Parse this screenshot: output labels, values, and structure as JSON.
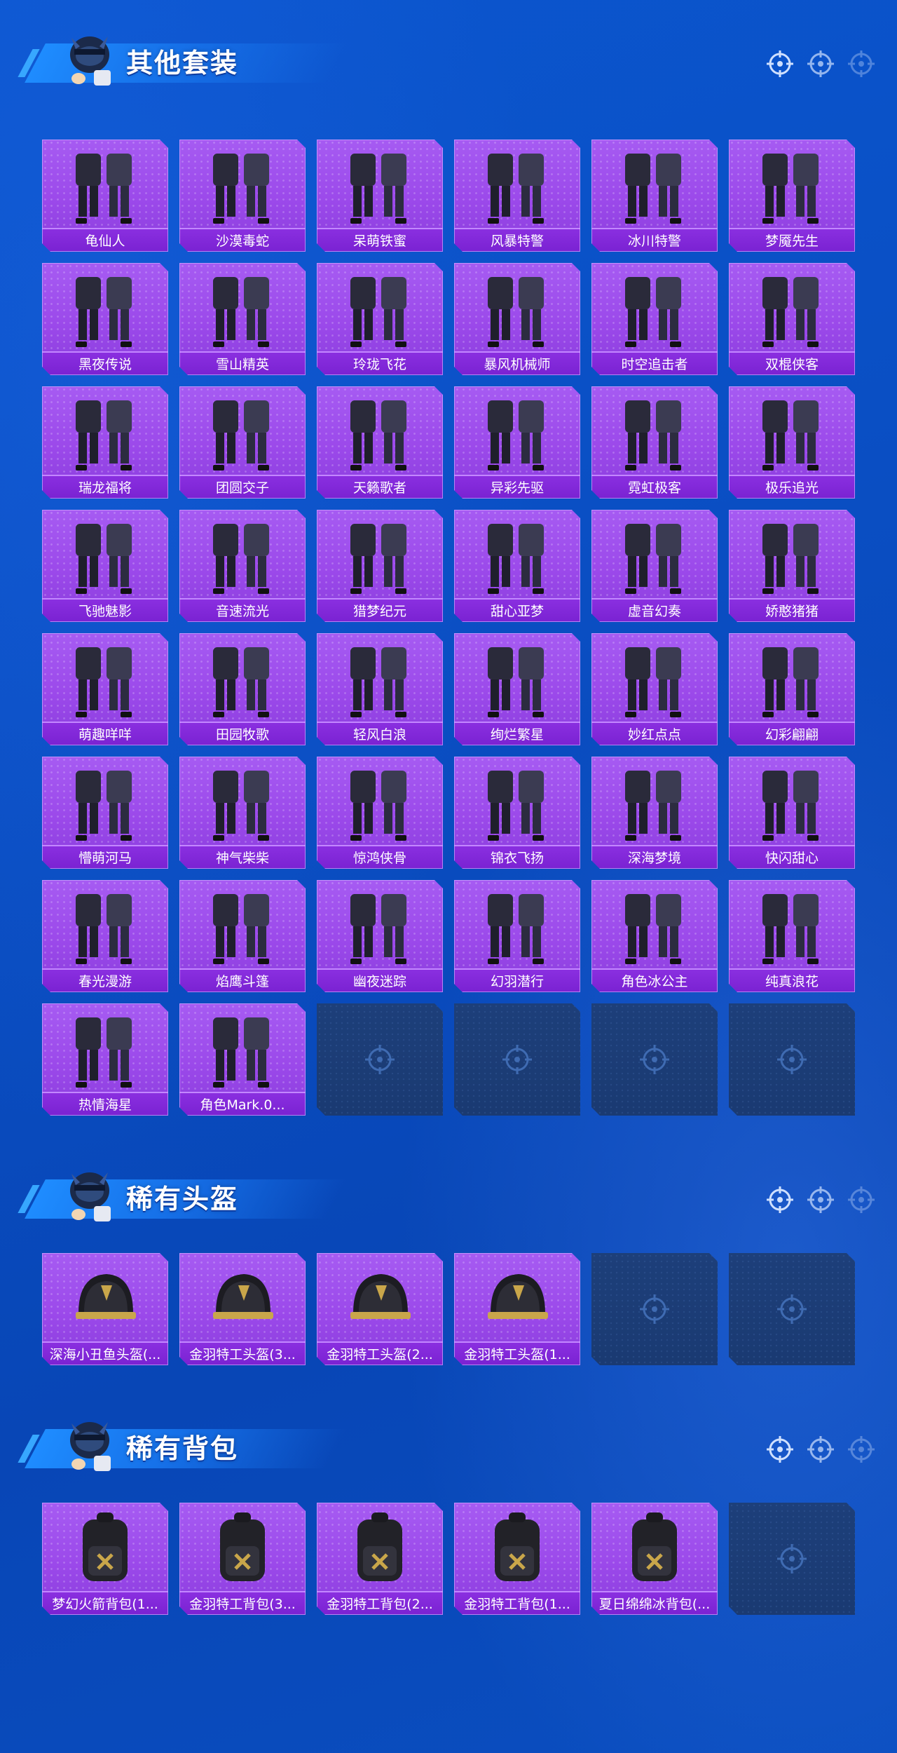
{
  "colors": {
    "background": "#0a4fc4",
    "card_purple": "#9b49ea",
    "label_bar": "#7a22d2",
    "empty_slot": "#1a3a72"
  },
  "sections": {
    "outfits": {
      "title": "其他套装",
      "items": [
        {
          "name": "龟仙人",
          "icon": "outfit-icon"
        },
        {
          "name": "沙漠毒蛇",
          "icon": "outfit-icon"
        },
        {
          "name": "呆萌铁蜜",
          "icon": "outfit-icon"
        },
        {
          "name": "风暴特警",
          "icon": "outfit-icon"
        },
        {
          "name": "冰川特警",
          "icon": "outfit-icon"
        },
        {
          "name": "梦魇先生",
          "icon": "outfit-icon"
        },
        {
          "name": "黑夜传说",
          "icon": "outfit-icon"
        },
        {
          "name": "雪山精英",
          "icon": "outfit-icon"
        },
        {
          "name": "玲珑飞花",
          "icon": "outfit-icon"
        },
        {
          "name": "暴风机械师",
          "icon": "outfit-icon"
        },
        {
          "name": "时空追击者",
          "icon": "outfit-icon"
        },
        {
          "name": "双棍侠客",
          "icon": "outfit-icon"
        },
        {
          "name": "瑞龙福将",
          "icon": "outfit-icon"
        },
        {
          "name": "团圆交子",
          "icon": "outfit-icon"
        },
        {
          "name": "天籁歌者",
          "icon": "outfit-icon"
        },
        {
          "name": "异彩先驱",
          "icon": "outfit-icon"
        },
        {
          "name": "霓虹极客",
          "icon": "outfit-icon"
        },
        {
          "name": "极乐追光",
          "icon": "outfit-icon"
        },
        {
          "name": "飞驰魅影",
          "icon": "outfit-icon"
        },
        {
          "name": "音速流光",
          "icon": "outfit-icon"
        },
        {
          "name": "猎梦纪元",
          "icon": "outfit-icon"
        },
        {
          "name": "甜心亚梦",
          "icon": "outfit-icon"
        },
        {
          "name": "虚音幻奏",
          "icon": "outfit-icon"
        },
        {
          "name": "娇憨猪猪",
          "icon": "outfit-icon"
        },
        {
          "name": "萌趣咩咩",
          "icon": "outfit-icon"
        },
        {
          "name": "田园牧歌",
          "icon": "outfit-icon"
        },
        {
          "name": "轻风白浪",
          "icon": "outfit-icon"
        },
        {
          "name": "绚烂繁星",
          "icon": "outfit-icon"
        },
        {
          "name": "妙红点点",
          "icon": "outfit-icon"
        },
        {
          "name": "幻彩翩翩",
          "icon": "outfit-icon"
        },
        {
          "name": "懵萌河马",
          "icon": "outfit-icon"
        },
        {
          "name": "神气柴柴",
          "icon": "outfit-icon"
        },
        {
          "name": "惊鸿侠骨",
          "icon": "outfit-icon"
        },
        {
          "name": "锦衣飞扬",
          "icon": "outfit-icon"
        },
        {
          "name": "深海梦境",
          "icon": "outfit-icon"
        },
        {
          "name": "快闪甜心",
          "icon": "outfit-icon"
        },
        {
          "name": "春光漫游",
          "icon": "outfit-icon"
        },
        {
          "name": "焰鹰斗篷",
          "icon": "outfit-icon"
        },
        {
          "name": "幽夜迷踪",
          "icon": "outfit-icon"
        },
        {
          "name": "幻羽潜行",
          "icon": "outfit-icon"
        },
        {
          "name": "角色冰公主",
          "icon": "outfit-icon"
        },
        {
          "name": "纯真浪花",
          "icon": "outfit-icon"
        },
        {
          "name": "热情海星",
          "icon": "outfit-icon"
        },
        {
          "name": "角色Mark.0...",
          "icon": "outfit-icon"
        }
      ],
      "empty_slots": 4
    },
    "helmets": {
      "title": "稀有头盔",
      "items": [
        {
          "name": "深海小丑鱼头盔(...",
          "icon": "helmet-icon"
        },
        {
          "name": "金羽特工头盔(3...",
          "icon": "helmet-icon"
        },
        {
          "name": "金羽特工头盔(2...",
          "icon": "helmet-icon"
        },
        {
          "name": "金羽特工头盔(1...",
          "icon": "helmet-icon"
        }
      ],
      "empty_slots": 2
    },
    "backpacks": {
      "title": "稀有背包",
      "items": [
        {
          "name": "梦幻火箭背包(1...",
          "icon": "backpack-icon"
        },
        {
          "name": "金羽特工背包(3...",
          "icon": "backpack-icon"
        },
        {
          "name": "金羽特工背包(2...",
          "icon": "backpack-icon"
        },
        {
          "name": "金羽特工背包(1...",
          "icon": "backpack-icon"
        },
        {
          "name": "夏日绵绵冰背包(...",
          "icon": "backpack-icon"
        }
      ],
      "empty_slots": 1
    }
  }
}
